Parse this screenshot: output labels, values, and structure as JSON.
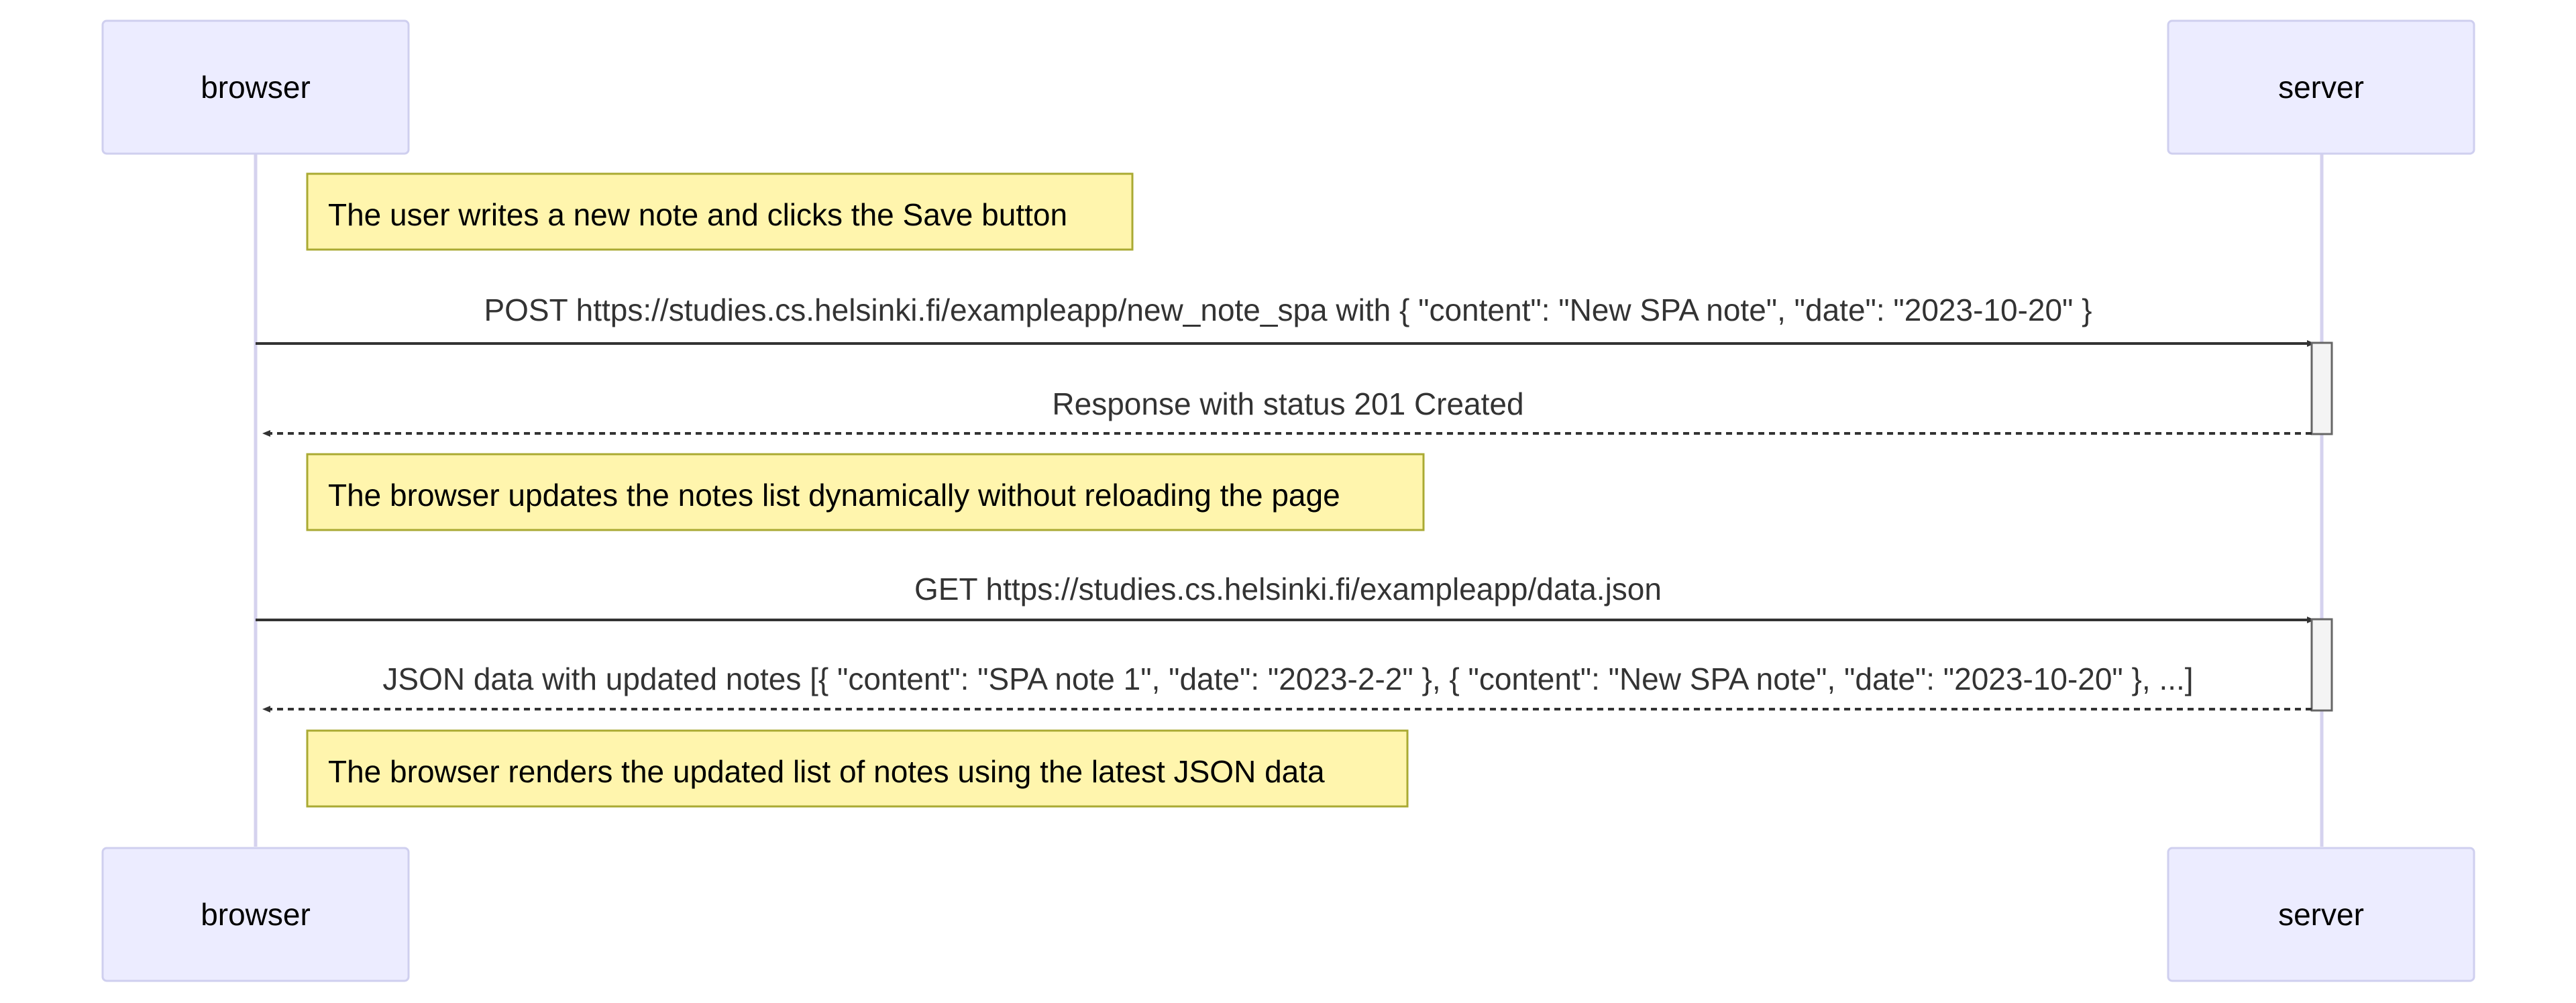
{
  "diagram": {
    "type": "sequence",
    "participants": [
      {
        "id": "browser",
        "label": "browser"
      },
      {
        "id": "server",
        "label": "server"
      }
    ],
    "notes": [
      {
        "over": "browser",
        "text": "The user writes a new note and clicks the Save button"
      },
      {
        "over": "browser",
        "text": "The browser updates the notes list dynamically without reloading the page"
      },
      {
        "over": "browser",
        "text": "The browser renders the updated list of notes using the latest JSON data"
      }
    ],
    "messages": [
      {
        "from": "browser",
        "to": "server",
        "style": "solid",
        "text": "POST https://studies.cs.helsinki.fi/exampleapp/new_note_spa with { \"content\": \"New SPA note\", \"date\": \"2023-10-20\" }"
      },
      {
        "from": "server",
        "to": "browser",
        "style": "dashed",
        "text": "Response with status 201 Created"
      },
      {
        "from": "browser",
        "to": "server",
        "style": "solid",
        "text": "GET https://studies.cs.helsinki.fi/exampleapp/data.json"
      },
      {
        "from": "server",
        "to": "browser",
        "style": "dashed",
        "text": "JSON data with updated notes [{ \"content\": \"SPA note 1\", \"date\": \"2023-2-2\" }, { \"content\": \"New SPA note\", \"date\": \"2023-10-20\" }, ...]"
      }
    ],
    "colors": {
      "actor_fill": "#ececff",
      "actor_border": "#cfcfef",
      "lifeline": "#d5d2ee",
      "note_fill": "#fff5ad",
      "note_border": "#aaaa33",
      "message_line": "#333333"
    }
  }
}
